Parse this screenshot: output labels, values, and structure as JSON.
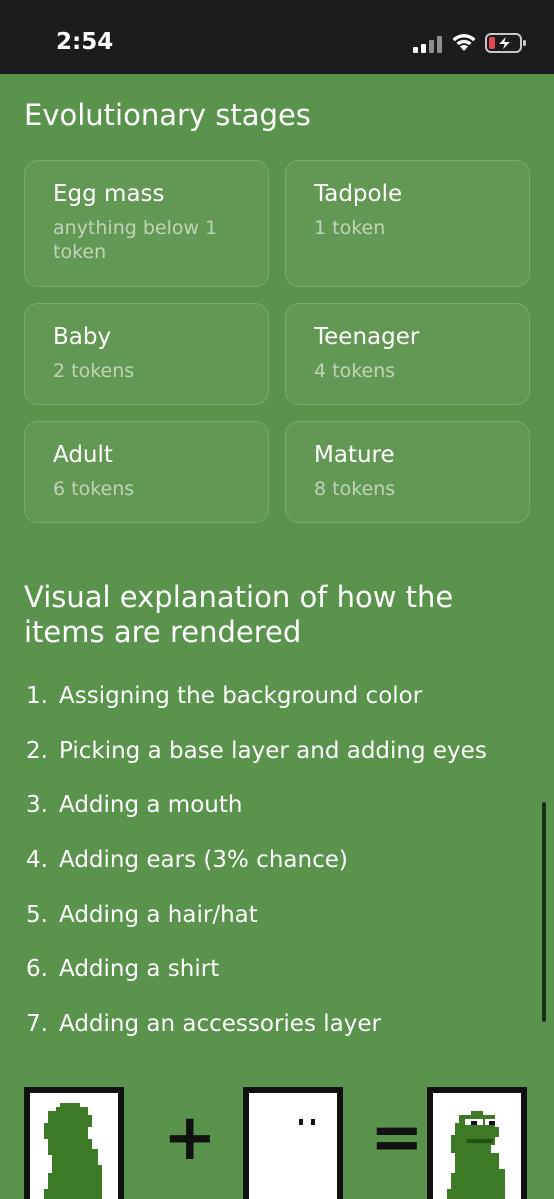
{
  "status_bar": {
    "time": "2:54",
    "icons": [
      "signal-icon",
      "wifi-icon",
      "battery-charging-icon"
    ],
    "battery_color": "#e5484d"
  },
  "theme": {
    "background": "#5a934b",
    "frog_color": "#3c7a26"
  },
  "stages_section": {
    "title": "Evolutionary stages",
    "stages": [
      {
        "name": "Egg mass",
        "value": "anything below 1 token"
      },
      {
        "name": "Tadpole",
        "value": "1 token"
      },
      {
        "name": "Baby",
        "value": "2 tokens"
      },
      {
        "name": "Teenager",
        "value": "4 tokens"
      },
      {
        "name": "Adult",
        "value": "6 tokens"
      },
      {
        "name": "Mature",
        "value": "8 tokens"
      }
    ]
  },
  "visual_section": {
    "title": "Visual explanation of how the items are rendered",
    "steps": [
      {
        "num": "1.",
        "text": "Assigning the background color"
      },
      {
        "num": "2.",
        "text": "Picking a base layer and adding eyes"
      },
      {
        "num": "3.",
        "text": "Adding a mouth"
      },
      {
        "num": "4.",
        "text": "Adding ears (3% chance)"
      },
      {
        "num": "5.",
        "text": "Adding a hair/hat"
      },
      {
        "num": "6.",
        "text": "Adding a shirt"
      },
      {
        "num": "7.",
        "text": "Adding an accessories layer"
      }
    ],
    "equation": {
      "plus": "+",
      "equals": "="
    }
  }
}
